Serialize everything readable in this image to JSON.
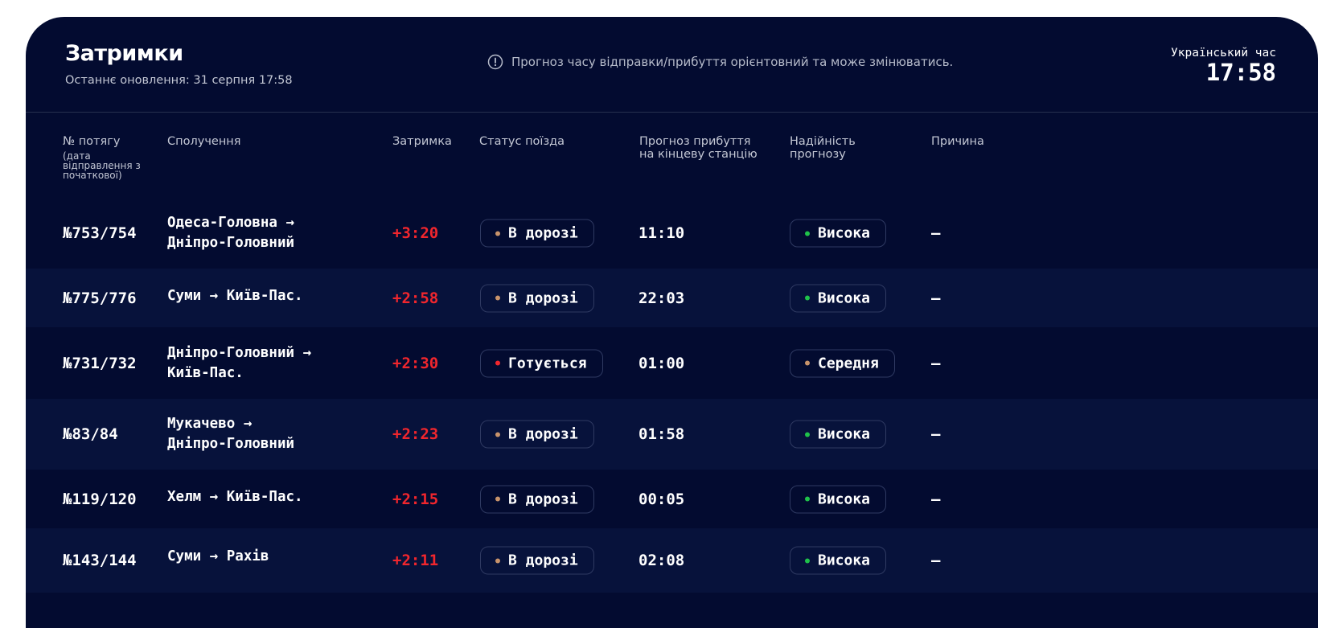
{
  "header": {
    "title": "Затримки",
    "updated": "Останнє оновлення: 31 серпня 17:58",
    "notice": "Прогноз часу відправки/прибуття орієнтовний та може змінюватись.",
    "clock_label": "Український час",
    "clock_time": "17:58"
  },
  "columns": {
    "train": "№ потягу",
    "train_sub": "(дата відправлення з початкової)",
    "route": "Сполучення",
    "delay": "Затримка",
    "status": "Статус поїзда",
    "eta": "Прогноз прибуття на кінцеву станцію",
    "reliability": "Надійність прогнозу",
    "reason": "Причина"
  },
  "colors": {
    "background": "#030b30",
    "delay": "#f1262d",
    "status_on_way": "#c8936b",
    "status_preparing": "#f1262d",
    "reliability_high": "#1fc24a",
    "reliability_medium": "#c8936b"
  },
  "rows": [
    {
      "train": "№753/754",
      "route1": "Одеса-Головна →",
      "route2": "Дніпро-Головний",
      "delay": "+3:20",
      "status": "В дорозі",
      "status_color": "#c8936b",
      "eta": "11:10",
      "reliability": "Висока",
      "reliability_color": "#1fc24a",
      "reason": "—"
    },
    {
      "train": "№775/776",
      "route1": "Суми → Київ-Пас.",
      "route2": "",
      "delay": "+2:58",
      "status": "В дорозі",
      "status_color": "#c8936b",
      "eta": "22:03",
      "reliability": "Висока",
      "reliability_color": "#1fc24a",
      "reason": "—"
    },
    {
      "train": "№731/732",
      "route1": "Дніпро-Головний →",
      "route2": "Київ-Пас.",
      "delay": "+2:30",
      "status": "Готується",
      "status_color": "#f1262d",
      "eta": "01:00",
      "reliability": "Середня",
      "reliability_color": "#c8936b",
      "reason": "—"
    },
    {
      "train": "№83/84",
      "route1": "Мукачево →",
      "route2": "Дніпро-Головний",
      "delay": "+2:23",
      "status": "В дорозі",
      "status_color": "#c8936b",
      "eta": "01:58",
      "reliability": "Висока",
      "reliability_color": "#1fc24a",
      "reason": "—"
    },
    {
      "train": "№119/120",
      "route1": "Хелм → Київ-Пас.",
      "route2": "",
      "delay": "+2:15",
      "status": "В дорозі",
      "status_color": "#c8936b",
      "eta": "00:05",
      "reliability": "Висока",
      "reliability_color": "#1fc24a",
      "reason": "—"
    },
    {
      "train": "№143/144",
      "route1": "Суми → Рахів",
      "route2": "",
      "delay": "+2:11",
      "status": "В дорозі",
      "status_color": "#c8936b",
      "eta": "02:08",
      "reliability": "Висока",
      "reliability_color": "#1fc24a",
      "reason": "—"
    }
  ]
}
